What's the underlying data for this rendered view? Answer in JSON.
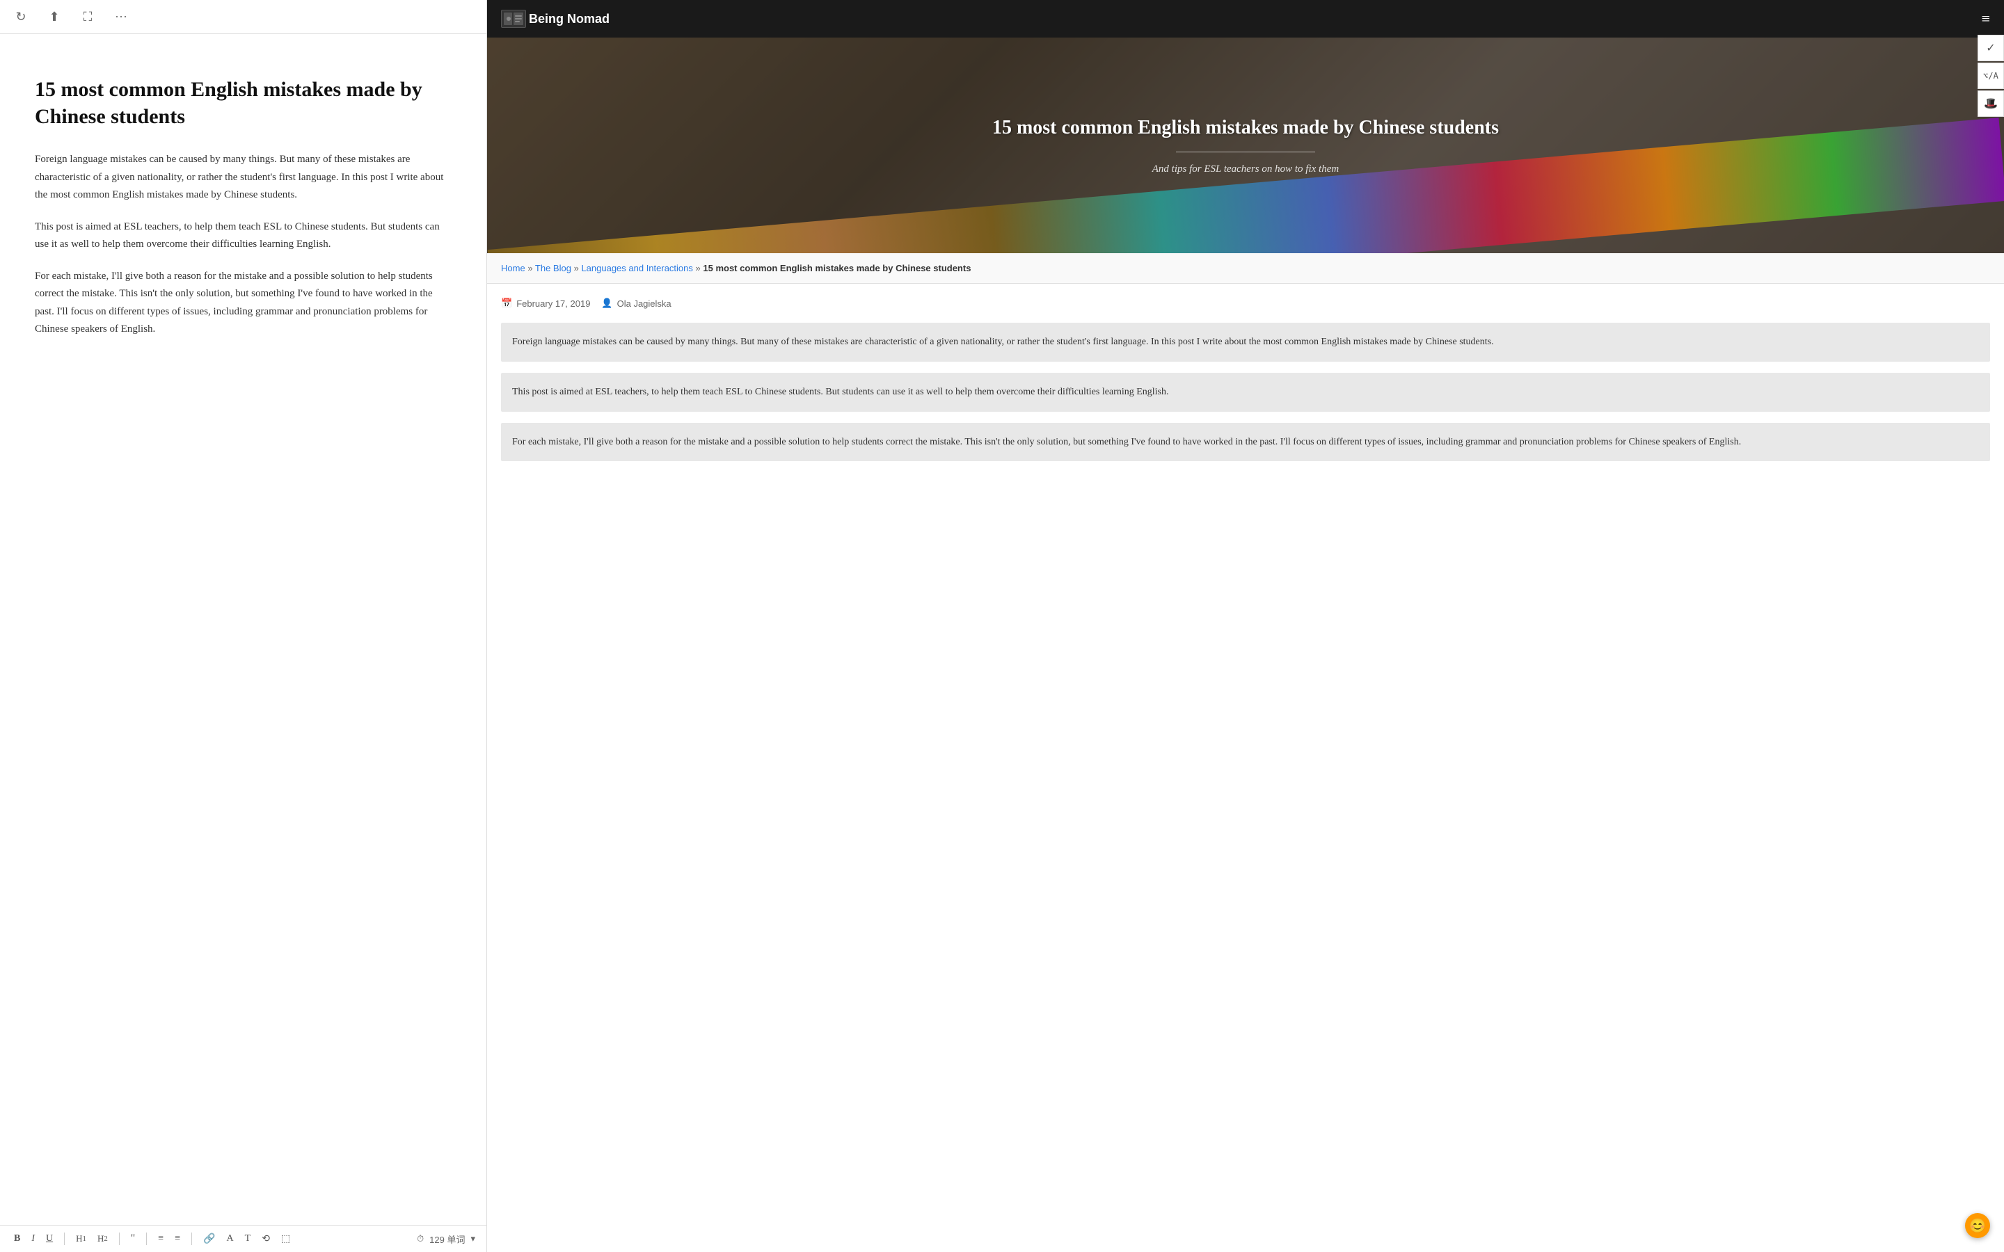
{
  "left": {
    "toolbar": {
      "refresh_icon": "↻",
      "share_icon": "⬆",
      "fullscreen_icon": "⛶",
      "more_icon": "···"
    },
    "article": {
      "title": "15 most common English mistakes made by Chinese students",
      "paragraphs": [
        "Foreign language mistakes can be caused by many things. But many of these mistakes are characteristic of a given nationality, or rather the student's first language. In this post I write about the most common English mistakes made by Chinese students.",
        "This post is aimed at ESL teachers, to help them teach ESL to Chinese students. But students can use it as well to help them overcome their difficulties learning English.",
        "For each mistake, I'll give both a reason for the mistake and a possible solution to help students correct the mistake. This isn't the only solution, but something I've found to have worked in the past. I'll focus on different types of issues, including grammar and pronunciation problems for Chinese speakers of English."
      ]
    },
    "bottom_bar": {
      "buttons": [
        "B",
        "I",
        "U",
        "H1",
        "H2",
        "❝",
        "≡",
        "≡≡",
        "🔗",
        "A",
        "T",
        "⟲",
        "⬚"
      ],
      "word_count_icon": "⏱",
      "word_count": "129 单词",
      "word_count_arrow": "▾"
    }
  },
  "right": {
    "nav": {
      "logo_text": "Being Nomad",
      "hamburger": "≡"
    },
    "hero": {
      "title": "15 most common English mistakes made by Chinese students",
      "subtitle": "And tips for ESL teachers on how to fix them"
    },
    "breadcrumb": {
      "home": "Home",
      "separator1": "»",
      "blog": "The Blog",
      "separator2": "»",
      "category": "Languages and Interactions",
      "separator3": "»",
      "current": "15 most common English mistakes made by Chinese students"
    },
    "meta": {
      "date_icon": "📅",
      "date": "February 17, 2019",
      "author_icon": "👤",
      "author": "Ola Jagielska"
    },
    "paragraphs": [
      "Foreign language mistakes can be caused by many things. But many of these mistakes are characteristic of a given nationality, or rather the student's first language. In this post I write about the most common English mistakes made by Chinese students.",
      "This post is aimed at ESL teachers, to help them teach ESL to Chinese students. But students can use it as well to help them overcome their difficulties learning English.",
      "For each mistake, I'll give both a reason for the mistake and a possible solution to help students correct the mistake. This isn't the only solution, but something I've found to have worked in the past. I'll focus on different types of issues, including grammar and pronunciation problems for Chinese speakers of English."
    ],
    "sidebar_icons": {
      "check": "✓",
      "code": "⌥",
      "hat": "🎩"
    },
    "floating_emoji": "😊"
  }
}
